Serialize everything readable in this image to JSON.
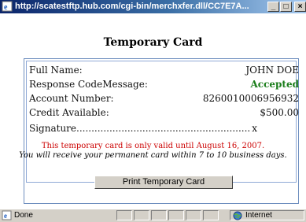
{
  "window": {
    "title": "http://scatestftp.hub.com/cgi-bin/merchxfer.dll/CC7E7A..."
  },
  "page": {
    "heading": "Temporary Card"
  },
  "card": {
    "rows": [
      {
        "label": "Full Name:",
        "value": "JOHN DOE"
      },
      {
        "label": "Response CodeMessage:",
        "value": "Accepted"
      },
      {
        "label": "Account Number:",
        "value": "8260010006956932"
      },
      {
        "label": "Credit Available:",
        "value": "$500.00"
      },
      {
        "label": "Signature..............................................................",
        "value": "x"
      }
    ],
    "validity_notice": "This temporary card is only valid until August 16, 2007.",
    "permanent_notice": "You will receive your permanent card within 7 to 10 business days."
  },
  "actions": {
    "print_label": "Print Temporary Card"
  },
  "statusbar": {
    "status_text": "Done",
    "zone_text": "Internet"
  },
  "colors": {
    "accepted": "#1a7d1a",
    "notice": "#cc0000",
    "card_border": "#6f8fbf"
  }
}
